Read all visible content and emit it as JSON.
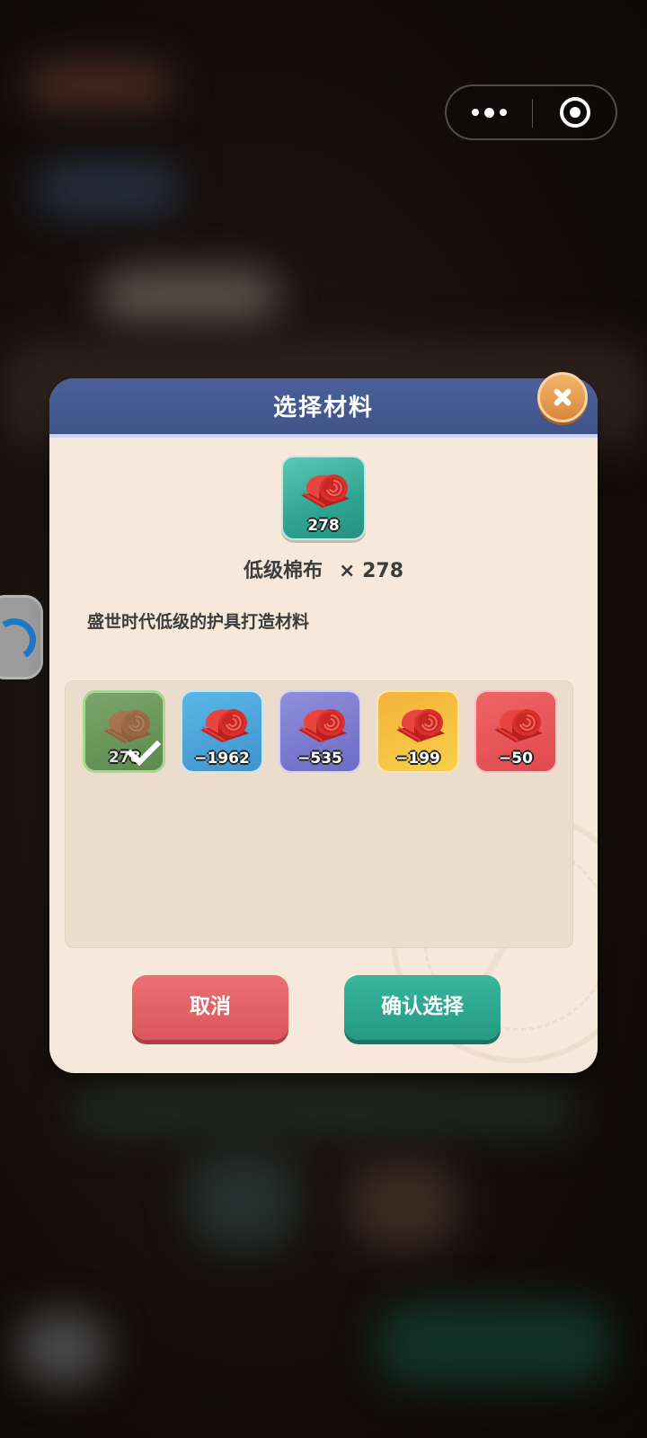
{
  "top_capsule": {
    "menu_icon": "more-dots-icon",
    "target_icon": "target-icon"
  },
  "side_widget": {
    "icon": "loading-arc-icon"
  },
  "dialog": {
    "title": "选择材料",
    "close_icon": "close-x-icon",
    "selected_item": {
      "icon": "cloth-roll-icon",
      "count": "278",
      "name": "低级棉布",
      "quantity_label": "× 278",
      "description": "盛世时代低级的护具打造材料"
    },
    "material_options": [
      {
        "rarity_color": "#6f9a60",
        "count": "278",
        "selected": true
      },
      {
        "rarity_color": "#4ea8dd",
        "count": "−1962",
        "selected": false
      },
      {
        "rarity_color": "#7f7dd2",
        "count": "−535",
        "selected": false
      },
      {
        "rarity_color": "#f4c041",
        "count": "−199",
        "selected": false
      },
      {
        "rarity_color": "#e85758",
        "count": "−50",
        "selected": false
      }
    ],
    "cancel_label": "取消",
    "confirm_label": "确认选择"
  }
}
